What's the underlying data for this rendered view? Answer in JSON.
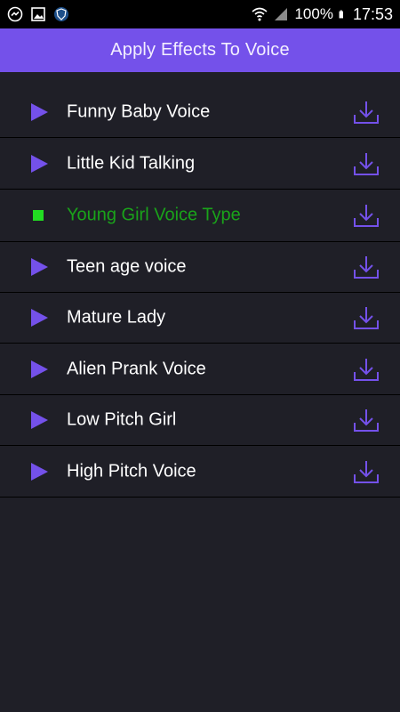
{
  "statusbar": {
    "battery": "100%",
    "time": "17:53",
    "left_icons": [
      "messenger-icon",
      "image-icon",
      "shield-icon"
    ],
    "right_icons": [
      "wifi-icon",
      "signal-icon",
      "battery-icon"
    ]
  },
  "appbar": {
    "title": "Apply Effects To Voice"
  },
  "colors": {
    "accent": "#7451ea",
    "background": "#1f1f27",
    "active_text": "#1aa31a",
    "active_icon": "#22dd22"
  },
  "effects": [
    {
      "label": "Funny Baby Voice",
      "state": "play",
      "icon": "play-icon"
    },
    {
      "label": "Little Kid Talking",
      "state": "play",
      "icon": "play-icon"
    },
    {
      "label": "Young Girl Voice Type",
      "state": "playing",
      "icon": "stop-icon"
    },
    {
      "label": "Teen age voice",
      "state": "play",
      "icon": "play-icon"
    },
    {
      "label": "Mature Lady",
      "state": "play",
      "icon": "play-icon"
    },
    {
      "label": "Alien Prank Voice",
      "state": "play",
      "icon": "play-icon"
    },
    {
      "label": "Low Pitch Girl",
      "state": "play",
      "icon": "play-icon"
    },
    {
      "label": "High Pitch Voice",
      "state": "play",
      "icon": "play-icon"
    }
  ]
}
